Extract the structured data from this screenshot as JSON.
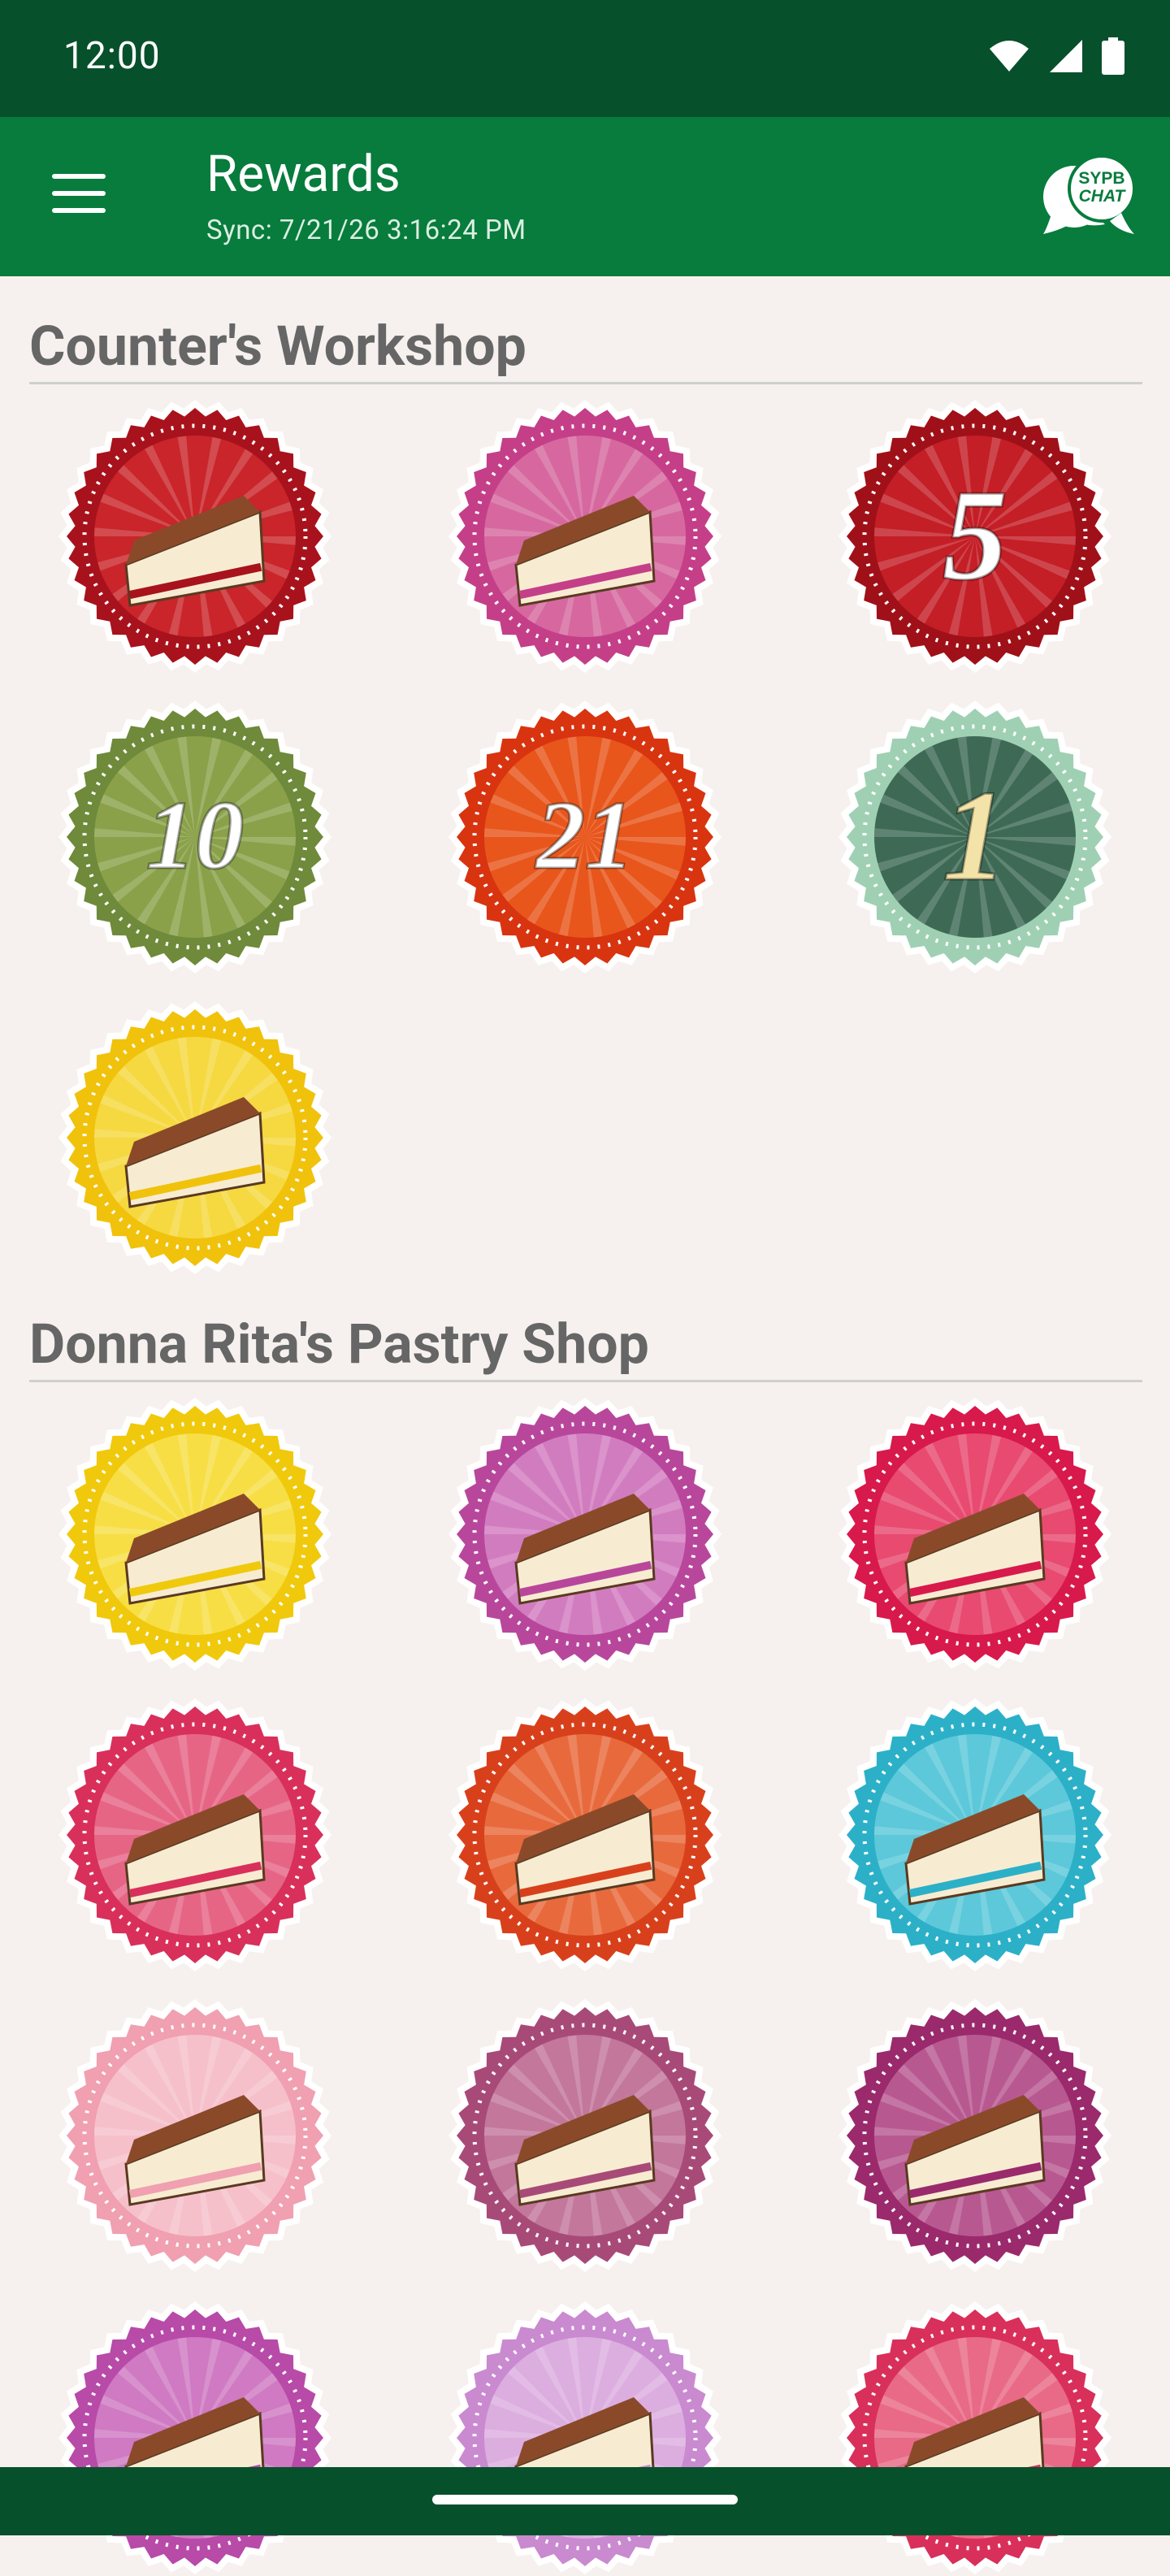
{
  "status_bar": {
    "time": "12:00"
  },
  "app_bar": {
    "title": "Rewards",
    "sync": "Sync: 7/21/26 3:16:24 PM",
    "chat_icon_text_1": "SYPB",
    "chat_icon_text_2": "CHAT"
  },
  "sections": [
    {
      "title": "Counter's Workshop",
      "badges": [
        {
          "icon": "apple-tape-measure-icon",
          "ring": "#a8121c",
          "inner": "#c9252a"
        },
        {
          "icon": "green-apple-icon",
          "ring": "#c43f88",
          "inner": "#d6689f"
        },
        {
          "icon": "number-five-icon",
          "label": "5",
          "ring": "#a01018",
          "inner": "#c41e26"
        },
        {
          "icon": "wreath-ten-icon",
          "label": "10",
          "ring": "#6e8a3a",
          "inner": "#8aa14a"
        },
        {
          "icon": "apple-twenty-one-icon",
          "label": "21",
          "ring": "#d83410",
          "inner": "#e8561b"
        },
        {
          "icon": "trophy-one-icon",
          "label": "1",
          "ring": "#9fd0b4",
          "inner": "#3e6a55"
        },
        {
          "icon": "ladybug-tape-measure-icon",
          "ring": "#f0c20c",
          "inner": "#f6d840"
        }
      ]
    },
    {
      "title": "Donna Rita's Pastry Shop",
      "badges": [
        {
          "icon": "strawberry-cheesecake-icon",
          "ring": "#f0c90c",
          "inner": "#f7de45"
        },
        {
          "icon": "lime-cake-icon",
          "ring": "#b8479c",
          "inner": "#d27cc0"
        },
        {
          "icon": "lemon-cake-icon",
          "ring": "#d8194b",
          "inner": "#e84a70"
        },
        {
          "icon": "chocolate-fudge-cake-icon",
          "ring": "#d8305a",
          "inner": "#e66585"
        },
        {
          "icon": "layered-chocolate-cake-icon",
          "ring": "#d8401c",
          "inner": "#e86a3c"
        },
        {
          "icon": "rainbow-cake-icon",
          "ring": "#2cb0c8",
          "inner": "#5cc8da"
        },
        {
          "icon": "cookies-cream-cake-icon",
          "ring": "#f0a0b0",
          "inner": "#f6c0cb"
        },
        {
          "icon": "black-forest-cake-icon",
          "ring": "#a84a78",
          "inner": "#c2779b"
        },
        {
          "icon": "pastry-chef-icon",
          "ring": "#9a2a6c",
          "inner": "#b85891"
        },
        {
          "icon": "books-icon",
          "ring": "#b84aa8",
          "inner": "#cf7ac2"
        },
        {
          "icon": "raspberry-cake-icon",
          "ring": "#c98ad0",
          "inner": "#dcaee0"
        },
        {
          "icon": "berry-cake-icon",
          "ring": "#d8305a",
          "inner": "#e86a86"
        }
      ]
    }
  ]
}
